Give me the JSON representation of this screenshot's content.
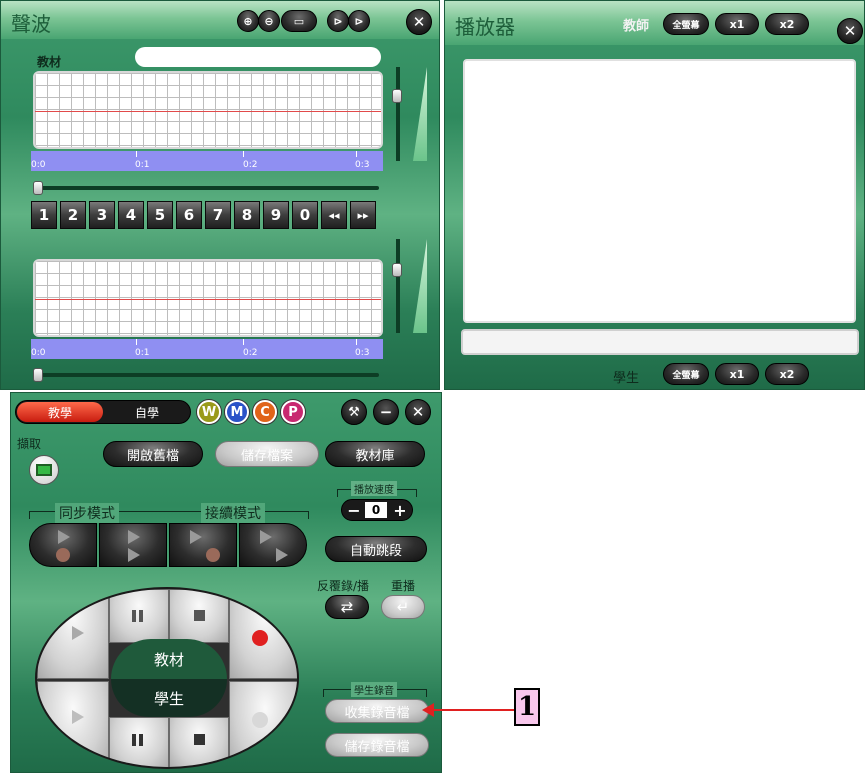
{
  "waveform": {
    "title": "聲波",
    "material_label": "教材",
    "timeline_ticks": [
      "0:0",
      "0:1",
      "0:2",
      "0:3"
    ],
    "number_keys": [
      "1",
      "2",
      "3",
      "4",
      "5",
      "6",
      "7",
      "8",
      "9",
      "0",
      "◂◂",
      "▸▸"
    ],
    "close": "✕"
  },
  "player": {
    "title": "播放器",
    "teacher_label": "教師",
    "student_label": "學生",
    "fullscreen_label": "全螢幕",
    "x1_label": "x1",
    "x2_label": "x2",
    "close": "✕"
  },
  "control": {
    "tab_teach": "教學",
    "tab_self": "自學",
    "badges": [
      "W",
      "M",
      "C",
      "P"
    ],
    "capture_label": "擷取",
    "open_file": "開啟舊檔",
    "save_file": "儲存檔案",
    "library": "教材庫",
    "sync_mode": "同步模式",
    "relay_mode": "接續模式",
    "speed_label": "播放速度",
    "speed_value": "0",
    "speed_minus": "−",
    "speed_plus": "+",
    "auto_jump": "自動跳段",
    "repeat_label": "反覆錄/播",
    "replay_label": "重播",
    "oval_material": "教材",
    "oval_student": "學生",
    "student_record_label": "學生錄音",
    "collect_recordings": "收集錄音檔",
    "save_recordings": "儲存錄音檔",
    "close": "✕",
    "minimize": "−"
  },
  "callout": {
    "number": "1"
  },
  "colors": {
    "accent_red": "#e02020",
    "timeline_blue": "#8f8ff2",
    "panel_green": "#3e9a6c",
    "callout_pink": "#f8c7ec"
  }
}
